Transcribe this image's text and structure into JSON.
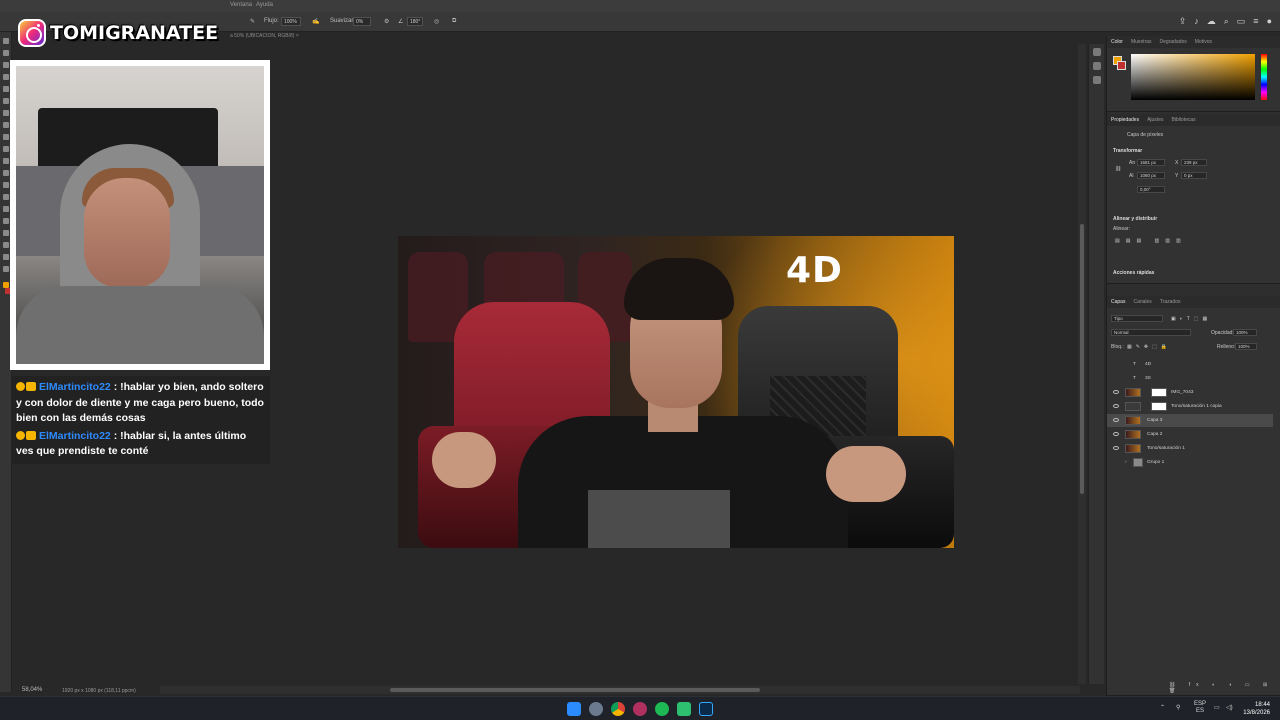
{
  "menubar": {
    "items": [
      "Ventana",
      "Ayuda"
    ]
  },
  "options_bar": {
    "flujo_label": "Flujo:",
    "flujo_value": "100%",
    "suavizar_label": "Suavizar:",
    "suavizar_value": "0%",
    "angle_value": "180°"
  },
  "doc_tab": {
    "label": "a 50% (UBICACION, RGB/8)",
    "close": "×"
  },
  "status": {
    "zoom": "58,04%",
    "info": "1920 px x 1080 px (118,11 ppcm)"
  },
  "overlay": {
    "handle": "TOMIGRANATEE",
    "chat": [
      {
        "user": "ElMartincito22",
        "text": " : !hablar yo bien, ando soltero y con dolor de diente y me caga pero bueno, todo bien con las demás cosas"
      },
      {
        "user": "ElMartincito22",
        "text": " : !hablar si, la antes último ves que prendiste te conté"
      }
    ]
  },
  "document": {
    "title_text": "4D"
  },
  "panels": {
    "color_tabs": [
      "Color",
      "Muestras",
      "Degradados",
      "Motivos"
    ],
    "colors": {
      "foreground": "#f0a000",
      "background": "#c03030"
    },
    "props_tabs": [
      "Propiedades",
      "Ajustes",
      "Bibliotecas"
    ],
    "props_layer_type": "Capa de píxeles",
    "transform_title": "Transformar",
    "an_label": "An",
    "an_value": "1681 px",
    "al_label": "Al",
    "al_value": "1080 px",
    "x_label": "X",
    "x_value": "239 px",
    "y_label": "Y",
    "y_value": "0 px",
    "angle_value": "0,00°",
    "align_title": "Alinear y distribuir",
    "align_label": "Alinear:",
    "quick_actions": "Acciones rápidas",
    "layers_tabs": [
      "Capas",
      "Canales",
      "Trazados"
    ],
    "filter_kind": "Tipo",
    "blend_mode": "Normal",
    "opacity_label": "Opacidad:",
    "opacity_value": "100%",
    "lock_label": "Bloq.:",
    "fill_label": "Relleno:",
    "fill_value": "100%",
    "layers": [
      {
        "name": "4D",
        "kind": "text"
      },
      {
        "name": "3S",
        "kind": "text"
      },
      {
        "name": "IMG_7043",
        "kind": "pixel-mask"
      },
      {
        "name": "Tono/saturación 1 copia",
        "kind": "adjustment"
      },
      {
        "name": "Capa 3",
        "kind": "pixel",
        "selected": true
      },
      {
        "name": "Capa 2",
        "kind": "pixel"
      },
      {
        "name": "Tono/saturación 1",
        "kind": "adjustment"
      },
      {
        "name": "Grupo 1",
        "kind": "group"
      }
    ]
  },
  "taskbar": {
    "lang_top": "ESP",
    "lang_bottom": "ES",
    "time": "18:44",
    "date": "13/8/2026"
  }
}
